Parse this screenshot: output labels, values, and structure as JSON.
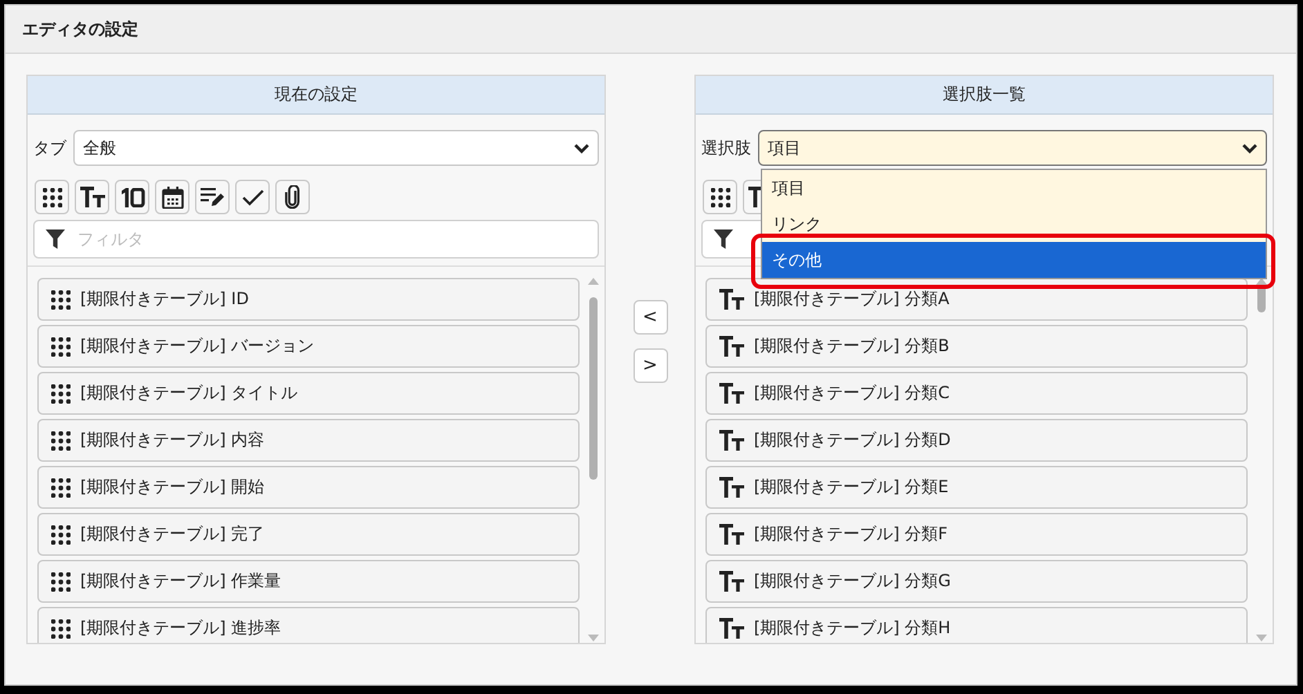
{
  "dialog": {
    "title": "エディタの設定"
  },
  "current": {
    "header": "現在の設定",
    "tab_label": "タブ",
    "tab_value": "全般",
    "filter_placeholder": "フィルタ",
    "items": [
      {
        "label": "[期限付きテーブル] ID",
        "kind": "table"
      },
      {
        "label": "[期限付きテーブル] バージョン",
        "kind": "table"
      },
      {
        "label": "[期限付きテーブル] タイトル",
        "kind": "table"
      },
      {
        "label": "[期限付きテーブル] 内容",
        "kind": "table"
      },
      {
        "label": "[期限付きテーブル] 開始",
        "kind": "table"
      },
      {
        "label": "[期限付きテーブル] 完了",
        "kind": "table"
      },
      {
        "label": "[期限付きテーブル] 作業量",
        "kind": "table"
      },
      {
        "label": "[期限付きテーブル] 進捗率",
        "kind": "table"
      }
    ]
  },
  "transfer_buttons": [
    "<",
    ">"
  ],
  "choices": {
    "header": "選択肢一覧",
    "choice_label": "選択肢",
    "choice_value": "項目",
    "dropdown": {
      "options": [
        {
          "label": "項目",
          "selected": false,
          "outlined": false
        },
        {
          "label": "リンク",
          "selected": false,
          "outlined": false
        },
        {
          "label": "その他",
          "selected": true,
          "outlined": true
        }
      ]
    },
    "items": [
      {
        "label": "[期限付きテーブル] 分類A",
        "kind": "text"
      },
      {
        "label": "[期限付きテーブル] 分類B",
        "kind": "text"
      },
      {
        "label": "[期限付きテーブル] 分類C",
        "kind": "text"
      },
      {
        "label": "[期限付きテーブル] 分類D",
        "kind": "text"
      },
      {
        "label": "[期限付きテーブル] 分類E",
        "kind": "text"
      },
      {
        "label": "[期限付きテーブル] 分類F",
        "kind": "text"
      },
      {
        "label": "[期限付きテーブル] 分類G",
        "kind": "text"
      },
      {
        "label": "[期限付きテーブル] 分類H",
        "kind": "text"
      }
    ]
  }
}
